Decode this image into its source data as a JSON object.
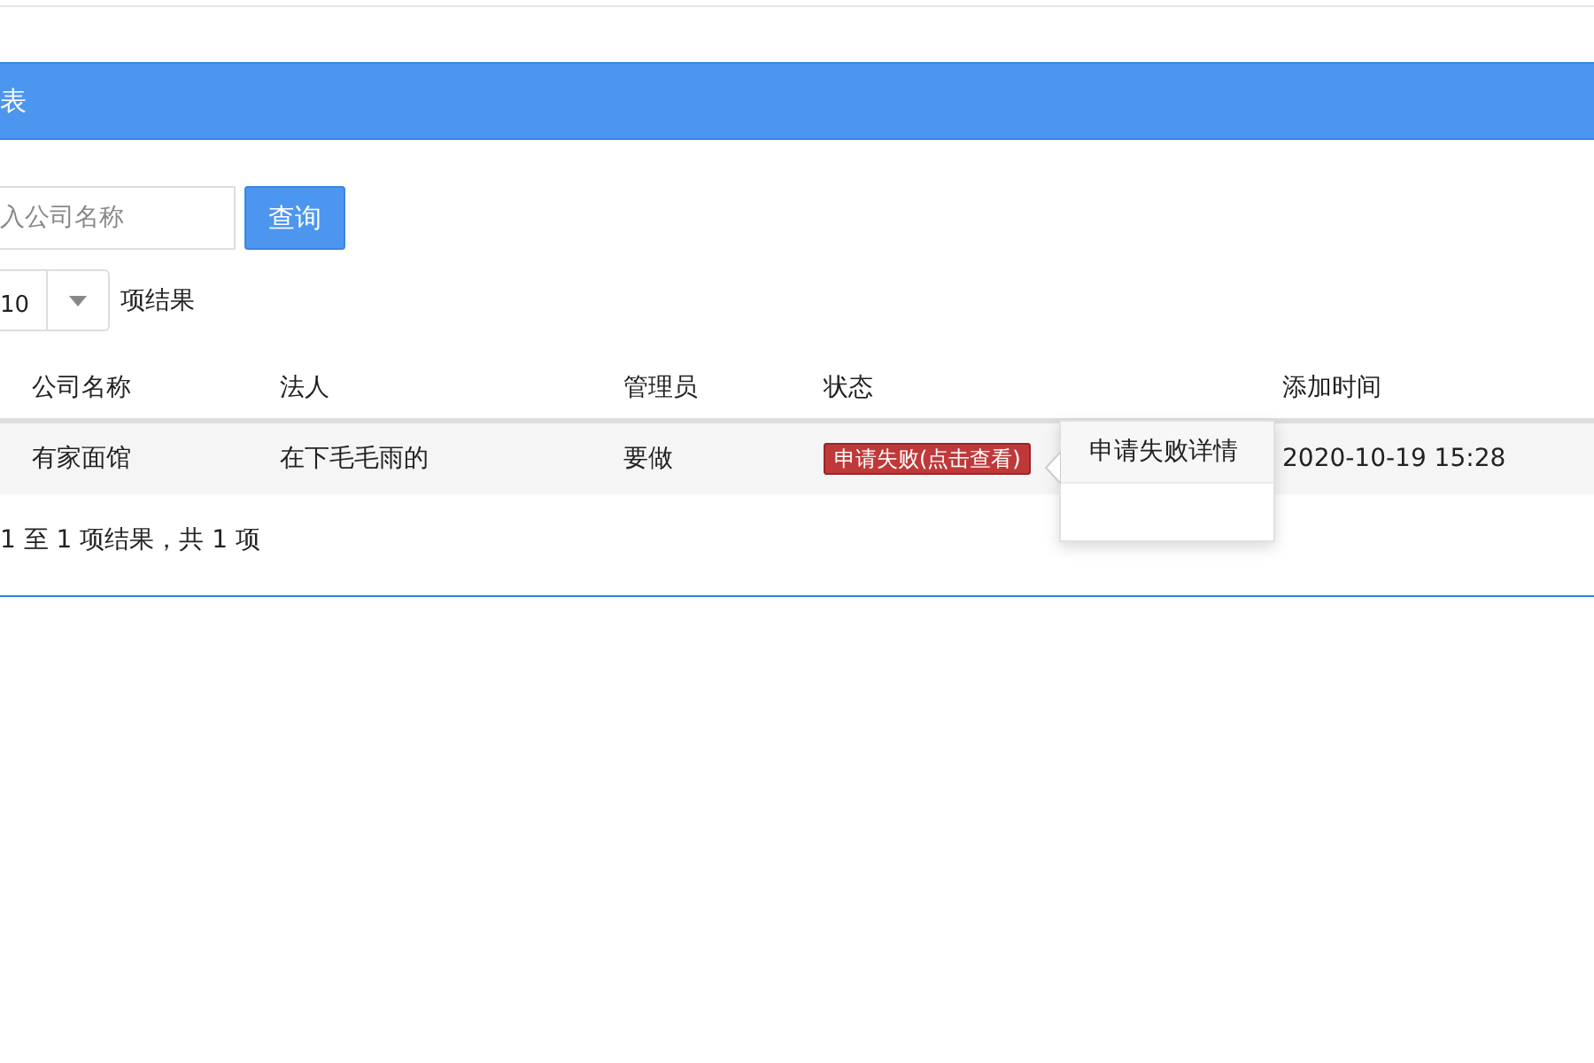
{
  "panel": {
    "title": "表"
  },
  "search": {
    "placeholder": "入公司名称",
    "button": "查询"
  },
  "page_size": {
    "value": "10",
    "suffix": "项结果"
  },
  "table": {
    "columns": [
      "公司名称",
      "法人",
      "管理员",
      "状态",
      "添加时间"
    ],
    "rows": [
      {
        "cells": [
          "有家面馆",
          "在下毛毛雨的",
          "要做",
          "申请失败(点击查看)",
          "2020-10-19 15:28"
        ]
      }
    ]
  },
  "popover": {
    "title": "申请失败详情"
  },
  "info": "1 至 1 项结果，共 1 项"
}
